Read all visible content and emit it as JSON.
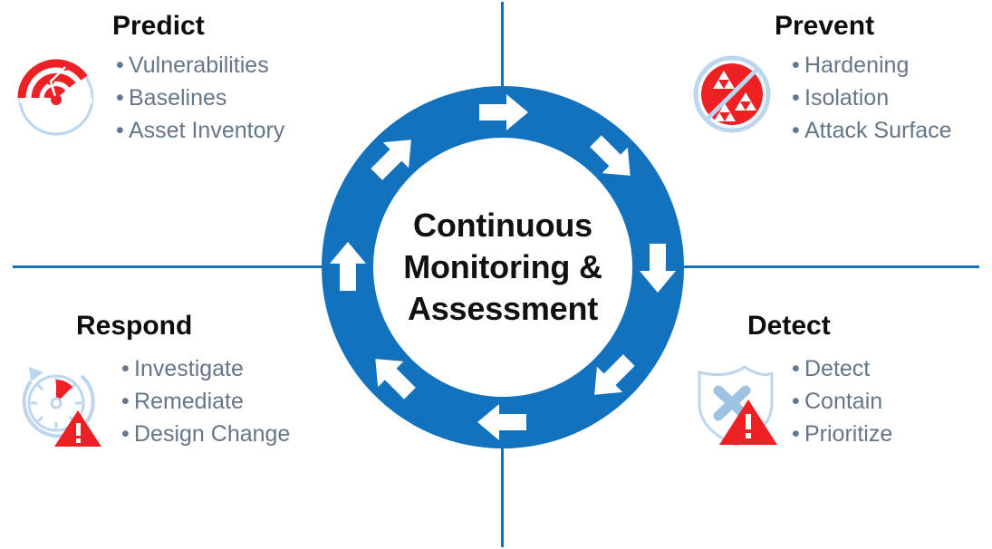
{
  "center": {
    "lines": [
      "Continuous",
      "Monitoring &",
      "Assessment"
    ],
    "ring_color": "#1272BE",
    "arrow_color": "#ffffff",
    "arrow_count": 8,
    "arrow_direction": "clockwise"
  },
  "colors": {
    "brand_blue": "#1272BE",
    "accent_red": "#ED2024",
    "icon_light_blue": "#BBD6EE",
    "bullet_text": "#647687",
    "title_text": "#0d0d0d",
    "divider": "#1272BE"
  },
  "quadrants": [
    {
      "id": "predict",
      "title": "Predict",
      "icon": "radar-signal-icon",
      "bullet_marker": "•",
      "bullets": [
        "Vulnerabilities",
        "Baselines",
        "Asset Inventory"
      ]
    },
    {
      "id": "prevent",
      "title": "Prevent",
      "icon": "no-entry-hazard-icon",
      "bullet_marker": "•",
      "bullets": [
        "Hardening",
        "Isolation",
        "Attack Surface"
      ]
    },
    {
      "id": "respond",
      "title": "Respond",
      "icon": "clock-alert-icon",
      "bullet_marker": "•",
      "bullets": [
        "Investigate",
        "Remediate",
        "Design Change"
      ]
    },
    {
      "id": "detect",
      "title": "Detect",
      "icon": "shield-alert-icon",
      "bullet_marker": "•",
      "bullets": [
        "Detect",
        "Contain",
        "Prioritize"
      ]
    }
  ]
}
